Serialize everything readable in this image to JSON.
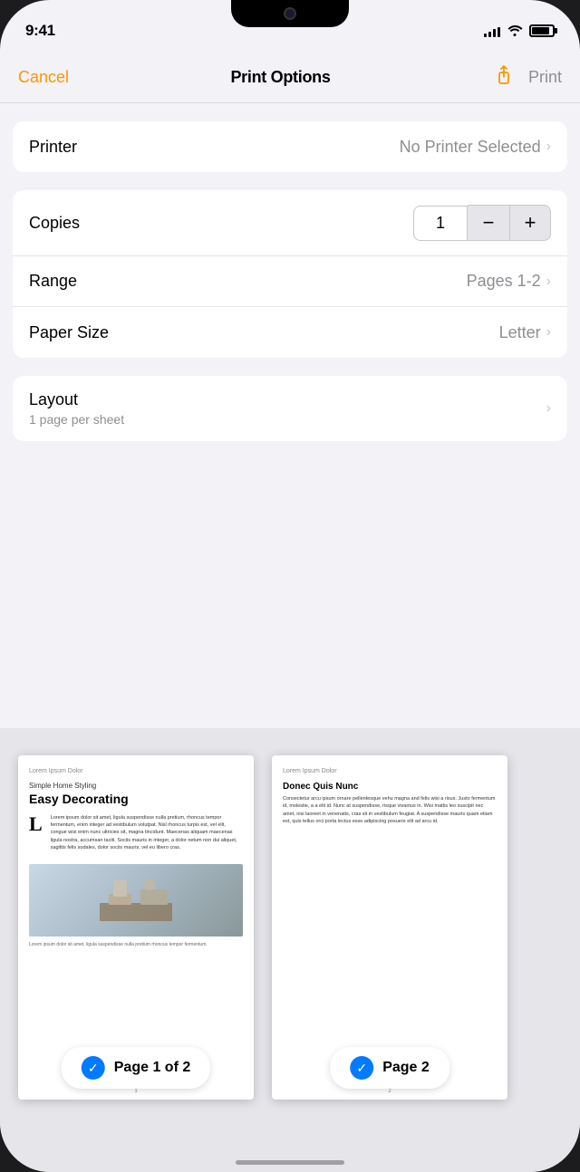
{
  "statusBar": {
    "time": "9:41",
    "signalBars": [
      4,
      6,
      9,
      11,
      13
    ],
    "wifiSymbol": "wifi",
    "batteryLevel": 85
  },
  "navBar": {
    "cancelLabel": "Cancel",
    "title": "Print Options",
    "shareIconName": "share-icon",
    "printLabel": "Print"
  },
  "printerSection": {
    "label": "Printer",
    "value": "No Printer Selected",
    "chevron": "›"
  },
  "copiesSection": {
    "label": "Copies",
    "value": "1",
    "decrementLabel": "−",
    "incrementLabel": "+"
  },
  "rangeSection": {
    "label": "Range",
    "value": "Pages 1-2",
    "chevron": "›"
  },
  "paperSizeSection": {
    "label": "Paper Size",
    "value": "Letter",
    "chevron": "›"
  },
  "layoutSection": {
    "label": "Layout",
    "subtitle": "1 page per sheet",
    "chevron": "›"
  },
  "preview": {
    "page1": {
      "loremTitle": "Lorem Ipsum Dolor",
      "articleSubtitle": "Simple Home Styling",
      "articleTitle": "Easy Decorating",
      "bodyText": "Lorem ipsum dolor sit amet, ligula suspendisse nulla pretium, rhoncus tempor fermentum, enim integer ad vestibulum volutpat. Nisl rhoncus turpis est, vel elit, congue wisi enim nunc ultricies sit, magna tincidunt. Maecenas aliquam maecenas ligula nostra, accumsan taciti. Sociis mauris in integer, a dolor netum non dui aliquet, sagittis felis sodales, dolor sociis mauris, vel eu libero cras.",
      "captionText": "Lorem ipsum dolor sit amet, ligula suspendisse nulla pretium rhoncus tempor fermentum.",
      "pageNum": "1",
      "label": "Page 1 of 2"
    },
    "page2": {
      "loremTitle": "Lorem Ipsum Dolor",
      "title": "Donec Quis Nunc",
      "bodyText": "Consectetur arcu ipsum ornare pellentesque vehu magna and felis wisi a risus. Justo fermentum id, molestie, a a elit id. Nunc at suspendisse, risque vivamus in. Wisi mattis leo suscipit nec amet, nisi laoreet in venenatis, cras sit in vestibulum feugiat. A suspendisse mauris quam etiam est, quis tellus orci porta lectus esse adipiscing posuere elit ad arcu id.",
      "pageNum": "2",
      "label": "Page 2"
    }
  },
  "colors": {
    "orange": "#ff9500",
    "blue": "#007aff",
    "gray": "#8e8e93",
    "lightGray": "#c7c7cc",
    "bg": "#f2f2f7"
  }
}
